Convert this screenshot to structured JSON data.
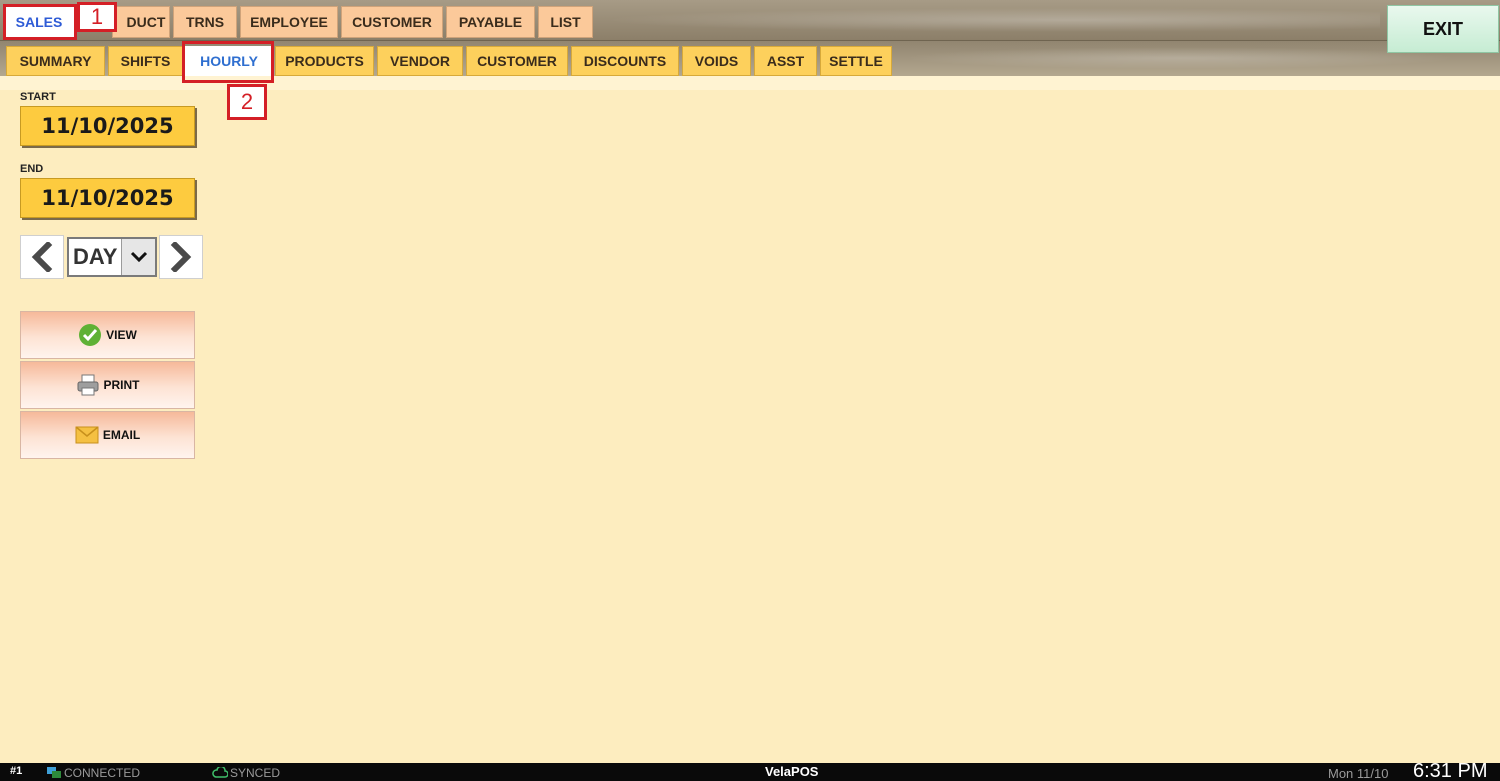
{
  "colors": {
    "background": "#fdedbf",
    "top_tab": "#fbc99a",
    "sub_tab": "#fdd05c",
    "active_tab": "#ffffff",
    "annotation": "#d41f26",
    "date_button": "#fdcb3f",
    "exit_button": "#c6ecd3"
  },
  "top_tabs": [
    {
      "label": "SALES",
      "active": true
    },
    {
      "label": "DUCT"
    },
    {
      "label": "TRNS"
    },
    {
      "label": "EMPLOYEE"
    },
    {
      "label": "CUSTOMER"
    },
    {
      "label": "PAYABLE"
    },
    {
      "label": "LIST"
    }
  ],
  "sub_tabs": [
    {
      "label": "SUMMARY"
    },
    {
      "label": "SHIFTS"
    },
    {
      "label": "HOURLY",
      "active": true
    },
    {
      "label": "PRODUCTS"
    },
    {
      "label": "VENDOR"
    },
    {
      "label": "CUSTOMER"
    },
    {
      "label": "DISCOUNTS"
    },
    {
      "label": "VOIDS"
    },
    {
      "label": "ASST"
    },
    {
      "label": "SETTLE"
    }
  ],
  "annotations": {
    "tag1": "1",
    "tag2": "2"
  },
  "exit_label": "EXIT",
  "filters": {
    "start_label": "START",
    "start_date": "11/10/2025",
    "end_label": "END",
    "end_date": "11/10/2025",
    "period": "DAY",
    "prev_icon": "chevron-left-icon",
    "next_icon": "chevron-right-icon"
  },
  "actions": {
    "view": {
      "label": "VIEW",
      "icon": "check-circle-icon"
    },
    "print": {
      "label": "PRINT",
      "icon": "printer-icon"
    },
    "email": {
      "label": "EMAIL",
      "icon": "envelope-icon"
    }
  },
  "statusbar": {
    "station": "#1",
    "connection": "CONNECTED",
    "sync": "SYNCED",
    "brand": "VelaPOS",
    "date": "Mon 11/10",
    "time": "6:31 PM"
  }
}
